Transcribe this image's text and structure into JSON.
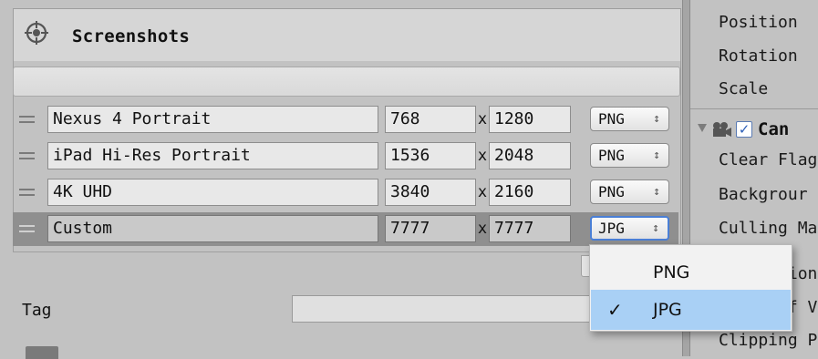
{
  "panel": {
    "title": "Screenshots"
  },
  "rows": [
    {
      "name": "Nexus 4 Portrait",
      "width": "768",
      "height": "1280",
      "format": "PNG"
    },
    {
      "name": "iPad Hi-Res Portrait",
      "width": "1536",
      "height": "2048",
      "format": "PNG"
    },
    {
      "name": "4K UHD",
      "width": "3840",
      "height": "2160",
      "format": "PNG"
    },
    {
      "name": "Custom",
      "width": "7777",
      "height": "7777",
      "format": "JPG"
    }
  ],
  "separator": "x",
  "format_arrows": "↕",
  "tag": {
    "label": "Tag",
    "value": ""
  },
  "dropdown": {
    "options": [
      "PNG",
      "JPG"
    ],
    "selected": "JPG",
    "check_glyph": "✓"
  },
  "inspector": {
    "transform": [
      "Position",
      "Rotation",
      "Scale"
    ],
    "camera": {
      "label": "Can",
      "enabled": true,
      "check_glyph": "✓",
      "properties": [
        "Clear Flag",
        "Backgrour",
        "Culling Ma",
        "Projection",
        "Field of Vi",
        "Clipping P"
      ]
    }
  },
  "colors": {
    "selected_row": "#8f8f8f",
    "dropdown_highlight": "#a9d0f5",
    "focus_border": "#4a7fd6"
  }
}
